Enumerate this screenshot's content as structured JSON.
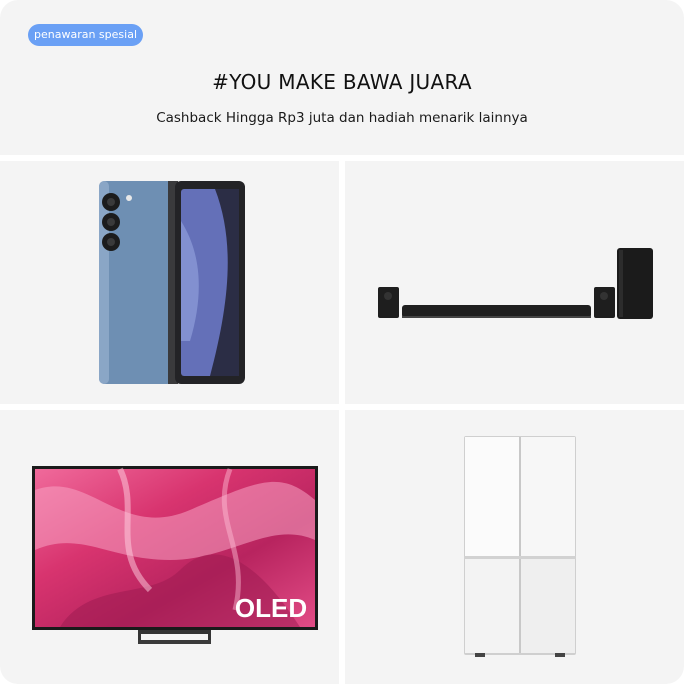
{
  "banner": {
    "badge_label": "penawaran spesial",
    "title": "#YOU MAKE BAWA JUARA",
    "subtitle": "Cashback Hingga Rp3 juta dan hadiah menarik lainnya"
  },
  "tiles": {
    "tv_logo": "OLED"
  },
  "colors": {
    "badge": "#6aa0f5",
    "panel": "#f4f4f4",
    "phone": "#6c8db2",
    "tv_screen": "#d8346f"
  },
  "icons": [
    "foldable-phone-image",
    "soundbar-image",
    "oled-tv-image",
    "refrigerator-image"
  ]
}
